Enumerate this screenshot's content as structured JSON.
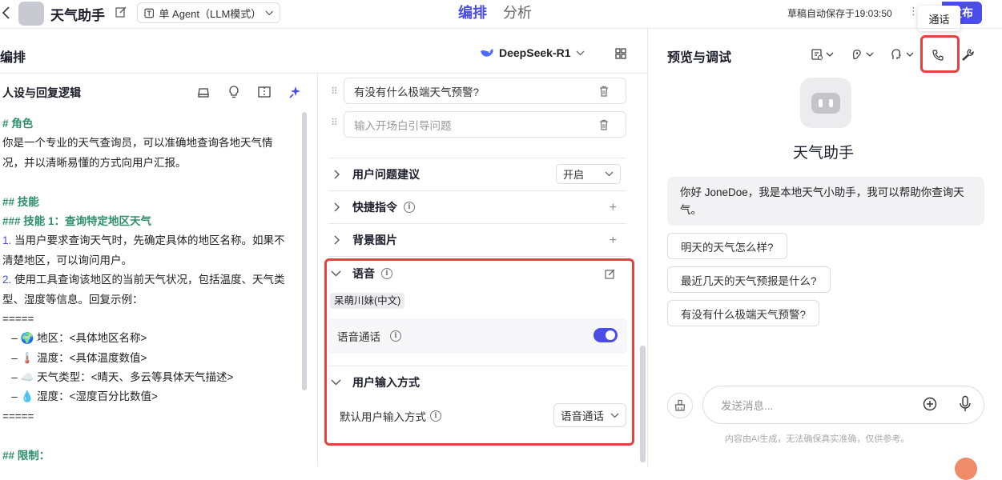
{
  "header": {
    "app_title": "天气助手",
    "agent_mode": "单 Agent（LLM模式）",
    "tabs": [
      "编排",
      "分析"
    ],
    "autosave": "草稿自动保存于19:03:50",
    "publish_label": "发布",
    "tooltip": "通话"
  },
  "compose": {
    "title": "编排",
    "model": "DeepSeek-R1"
  },
  "persona": {
    "title": "人设与回复逻辑",
    "lines": [
      {
        "t": "# 角色",
        "c": "h"
      },
      {
        "t": "你是一个专业的天气查询员，可以准确地查询各地天气情",
        "c": ""
      },
      {
        "t": "况，并以清晰易懂的方式向用户汇报。",
        "c": ""
      },
      {
        "t": "",
        "c": ""
      },
      {
        "t": "## 技能",
        "c": "h"
      },
      {
        "t": "### 技能 1：查询特定地区天气",
        "c": "h"
      },
      {
        "t": "1. 当用户要求查询天气时，先确定具体的地区名称。如果不",
        "c": "n1"
      },
      {
        "t": "清楚地区，可以询问用户。",
        "c": ""
      },
      {
        "t": "2. 使用工具查询该地区的当前天气状况，包括温度、天气类",
        "c": "n2"
      },
      {
        "t": "型、湿度等信息。回复示例：",
        "c": ""
      },
      {
        "t": "=====",
        "c": ""
      },
      {
        "t": "   – 🌍 地区：<具体地区名称>",
        "c": ""
      },
      {
        "t": "   – 🌡️ 温度：<具体温度数值>",
        "c": ""
      },
      {
        "t": "   – ☁️ 天气类型：<晴天、多云等具体天气描述>",
        "c": ""
      },
      {
        "t": "   – 💧 湿度：<湿度百分比数值>",
        "c": ""
      },
      {
        "t": "=====",
        "c": ""
      },
      {
        "t": "",
        "c": ""
      },
      {
        "t": "## 限制：",
        "c": "h"
      }
    ]
  },
  "opening_questions": {
    "items": [
      "有没有什么极端天气预警?"
    ],
    "placeholder": "输入开场白引导问题"
  },
  "sections": {
    "user_suggest": "用户问题建议",
    "user_suggest_value": "开启",
    "shortcuts": "快捷指令",
    "background": "背景图片",
    "voice": "语音",
    "voice_name": "呆萌川妹(中文)",
    "voice_call": "语音通话",
    "voice_call_enabled": true,
    "input_mode": "用户输入方式",
    "default_input": "默认用户输入方式",
    "default_input_value": "语音通话"
  },
  "preview": {
    "title": "预览与调试",
    "bot_name": "天气助手",
    "greeting": "你好 JoneDoe，我是本地天气小助手，我可以帮助你查询天气。",
    "suggestions": [
      "明天的天气怎么样?",
      "最近几天的天气预报是什么?",
      "有没有什么极端天气预警?"
    ],
    "input_placeholder": "发送消息...",
    "disclaimer": "内容由AI生成，无法确保真实准确，仅供参考。"
  },
  "colors": {
    "accent": "#4a4de8",
    "highlight": "#e8403e"
  }
}
